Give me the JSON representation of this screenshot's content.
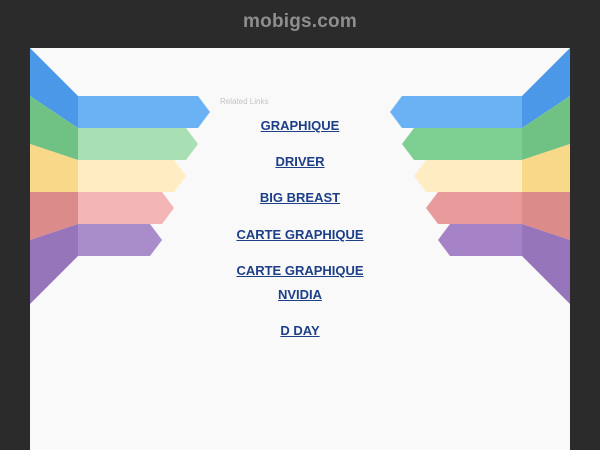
{
  "header": {
    "site_title": "mobigs.com"
  },
  "main": {
    "related_label": "Related Links",
    "links": [
      "GRAPHIQUE",
      "DRIVER",
      "BIG BREAST",
      "CARTE GRAPHIQUE",
      "CARTE GRAPHIQUE NVIDIA",
      "D DAY"
    ]
  },
  "colors": {
    "blue": "#5ba8f2",
    "green": "#7ed092",
    "yellow": "#fde4a4",
    "red": "#e89a9a",
    "purple": "#a583c6",
    "link": "#1c3f88",
    "background": "#2b2b2b",
    "panel": "#f9f9f9"
  }
}
